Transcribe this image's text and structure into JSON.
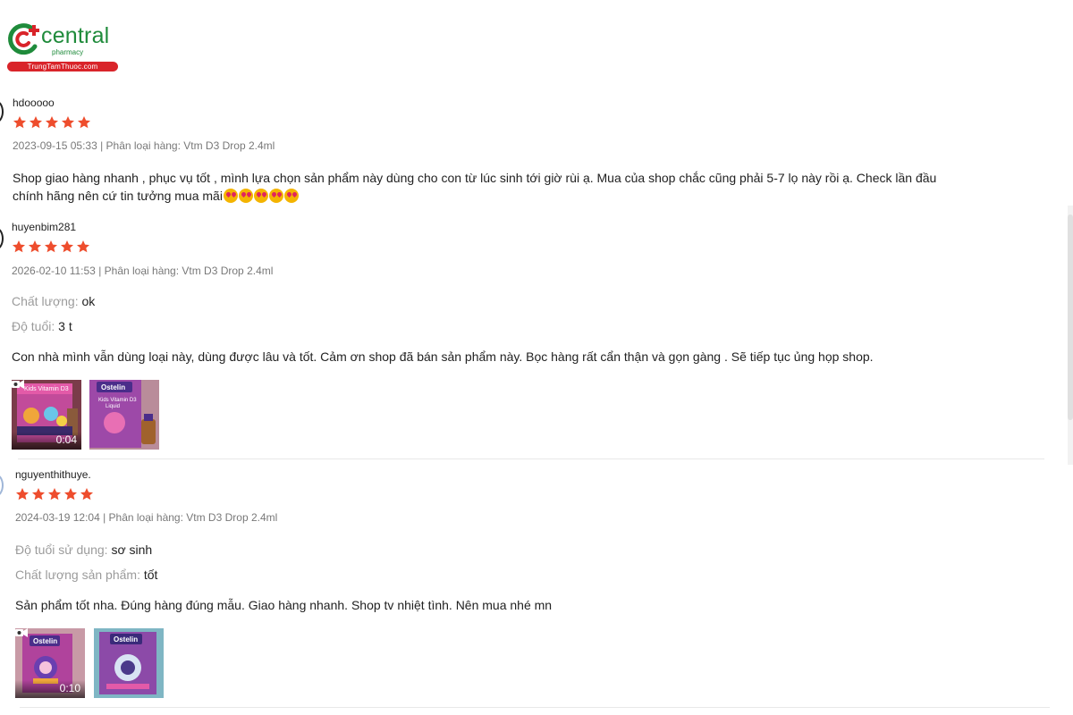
{
  "brand": {
    "name": "central",
    "sub": "pharmacy",
    "site": "TrungTamThuoc.com",
    "colors": {
      "green": "#1f8b3b",
      "red": "#d9242a"
    }
  },
  "star_color": "#ee4d2d",
  "reviews": [
    {
      "username": "hdooooo",
      "rating": 5,
      "meta": "2023-09-15 05:33 | Phân loại hàng: Vtm D3 Drop 2.4ml",
      "comment_line1": "Shop giao hàng nhanh , phục vụ tốt , mình lựa chọn sản phẩm này dùng cho con từ lúc sinh tới giờ rùi ạ. Mua của shop chắc cũng phải 5-7 lọ này rồi ạ. Check lần đầu",
      "comment_line2": "chính hãng nên cứ tin tưởng mua mãi",
      "emoji_count": 5,
      "emoji_name": "heart-eyes-emoji"
    },
    {
      "username": "huyenbim281",
      "rating": 5,
      "meta": "2026-02-10 11:53 | Phân loại hàng: Vtm D3 Drop 2.4ml",
      "attributes": [
        {
          "label": "Chất lượng:",
          "value": "ok"
        },
        {
          "label": "Độ tuổi:",
          "value": "3 t"
        }
      ],
      "comment": "Con nhà mình vẫn dùng loại này, dùng được lâu và tốt. Cảm ơn shop đã bán sản phẩm này. Bọc hàng rất cẩn thận và gọn gàng . Sẽ tiếp tục ủng họp shop.",
      "media": [
        {
          "type": "video",
          "duration": "0:04",
          "icon": "video-camera-icon"
        },
        {
          "type": "image",
          "caption": "Ostelin"
        }
      ]
    },
    {
      "username": "nguyenthithuye.",
      "rating": 5,
      "meta": "2024-03-19 12:04 | Phân loại hàng: Vtm D3 Drop 2.4ml",
      "attributes": [
        {
          "label": "Độ tuổi sử dụng:",
          "value": "sơ sinh"
        },
        {
          "label": "Chất lượng sản phẩm:",
          "value": "tốt"
        }
      ],
      "comment": "Sản phẩm tốt nha. Đúng hàng đúng mẫu. Giao hàng nhanh. Shop tv nhiệt tình. Nên mua nhé mn",
      "media": [
        {
          "type": "video",
          "duration": "0:10",
          "icon": "video-camera-icon"
        },
        {
          "type": "image",
          "caption": "Ostelin"
        }
      ]
    }
  ],
  "thumb_labels": {
    "kids_vitamin": "Kids Vitamin D3",
    "liquid": "Liquid",
    "ostelin": "Ostelin"
  }
}
